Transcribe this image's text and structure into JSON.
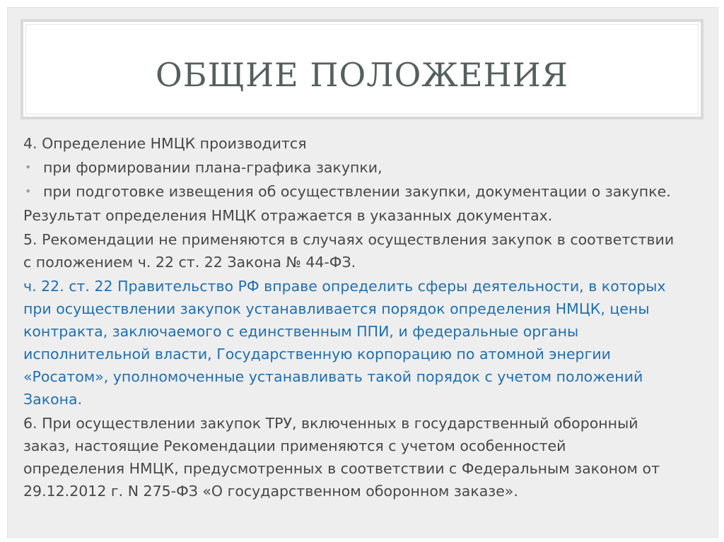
{
  "slide": {
    "title": "ОБЩИЕ ПОЛОЖЕНИЯ",
    "bullet_symbol": "•",
    "paragraphs": {
      "p4_intro": "4. Определение НМЦК производится",
      "p4_bullets": [
        "при формировании плана-графика закупки,",
        "при подготовке извещения об осуществлении закупки, документации о закупке."
      ],
      "p4_result": "Результат определения НМЦК отражается в указанных документах.",
      "p5_lines": [
        "5. Рекомендации не применяются в случаях осуществления закупок в соответствии",
        "с положением ч. 22 ст. 22 Закона № 44-ФЗ."
      ],
      "quote_lines": [
        "ч. 22. ст. 22 Правительство РФ вправе определить сферы деятельности, в которых",
        "при осуществлении закупок устанавливается порядок определения НМЦК, цены",
        "контракта, заключаемого с единственным ППИ, и федеральные органы",
        "исполнительной власти, Государственную корпорацию по атомной энергии",
        "«Росатом», уполномоченные устанавливать такой порядок с учетом положений",
        "Закона."
      ],
      "p6_lines": [
        "6. При осуществлении закупок ТРУ, включенных в государственный оборонный",
        "заказ, настоящие Рекомендации применяются с учетом особенностей",
        "определения НМЦК, предусмотренных в соответствии с Федеральным законом от",
        "29.12.2012 г. N 275-ФЗ «О государственном оборонном заказе»."
      ]
    },
    "colors": {
      "background": "#eeeeef",
      "title": "#55605e",
      "text": "#484848",
      "quote": "#1f6fb2"
    }
  }
}
